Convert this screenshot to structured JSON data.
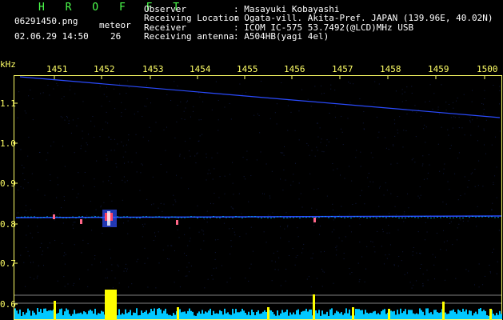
{
  "app": {
    "logo": "H R O F F T",
    "filename": "06291450.png",
    "datetime": "02.06.29 14:50",
    "meteor_label": "meteor",
    "meteor_count": "26"
  },
  "info": {
    "observer_label": "Observer",
    "observer_value": ": Masayuki Kobayashi",
    "location_label": "Receiving Location",
    "location_value": ": Ogata-vill. Akita-Pref. JAPAN (139.96E, 40.02N)",
    "receiver_label": "Receiver",
    "receiver_value": ": ICOM IC-575 53.7492(@LCD)MHz USB",
    "antenna_label": "Receiving antenna",
    "antenna_value": ": A504HB(yagi 4el)"
  },
  "axes": {
    "y_unit": "kHz",
    "x_ticks": [
      "1451",
      "1452",
      "1453",
      "1454",
      "1455",
      "1456",
      "1457",
      "1458",
      "1459",
      "1500"
    ],
    "y_ticks": [
      "1.1",
      "1.0",
      "0.9",
      "0.8",
      "0.7",
      "0.6"
    ]
  },
  "colors": {
    "background": "#000000",
    "label": "#ffff66",
    "logo": "#4cff4c",
    "trace": "#2a4bff",
    "meteor": "#ffff00",
    "activity": "#00c8ff"
  }
}
